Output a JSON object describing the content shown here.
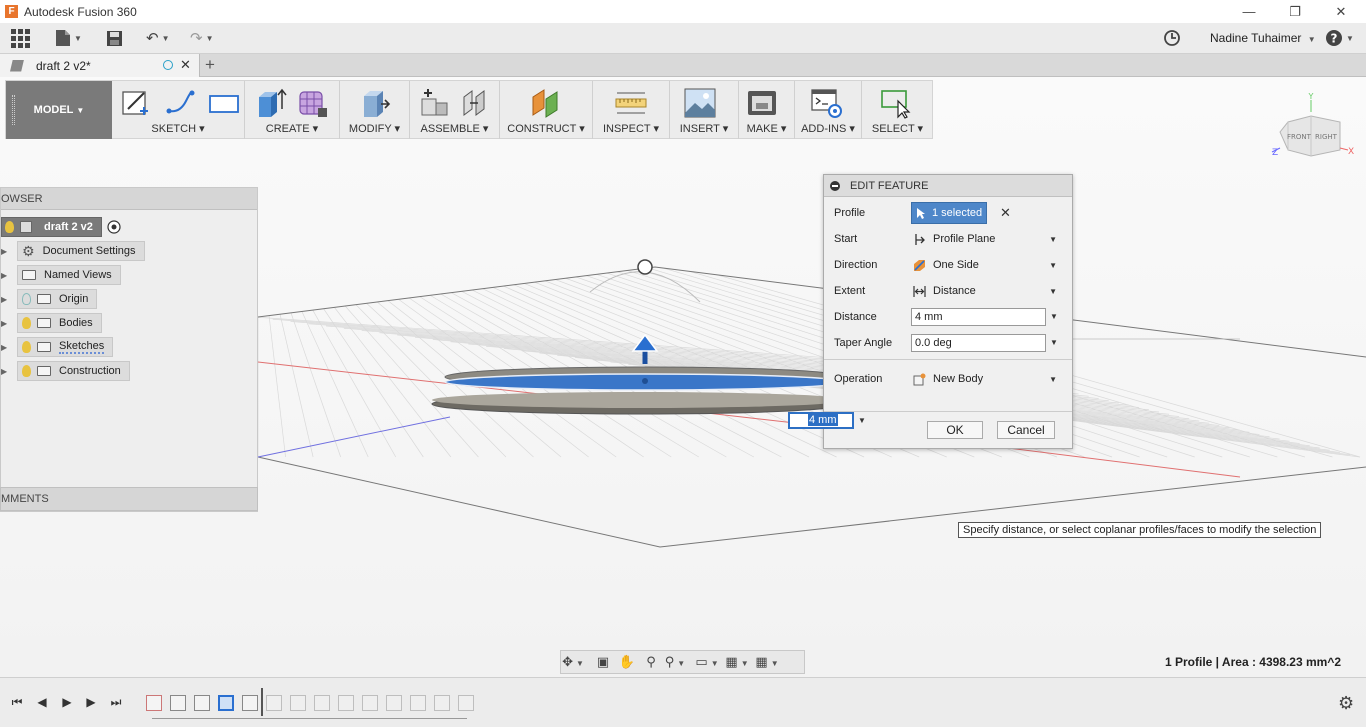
{
  "window": {
    "title": "Autodesk Fusion 360",
    "logo_letter": "F"
  },
  "quick_access": {
    "user": "Nadine Tuhaimer"
  },
  "document_tab": {
    "label": "draft 2 v2*"
  },
  "toolbar": {
    "workspace": "MODEL",
    "groups": [
      "SKETCH",
      "CREATE",
      "MODIFY",
      "ASSEMBLE",
      "CONSTRUCT",
      "INSPECT",
      "INSERT",
      "MAKE",
      "ADD-INS",
      "SELECT"
    ]
  },
  "browser": {
    "header": "OWSER",
    "root": "draft 2 v2",
    "items": [
      "Document Settings",
      "Named Views",
      "Origin",
      "Bodies",
      "Sketches",
      "Construction"
    ],
    "comments": "MMENTS"
  },
  "dialog": {
    "title": "EDIT FEATURE",
    "profile_label": "Profile",
    "profile_value": "1 selected",
    "start_label": "Start",
    "start_value": "Profile Plane",
    "direction_label": "Direction",
    "direction_value": "One Side",
    "extent_label": "Extent",
    "extent_value": "Distance",
    "distance_label": "Distance",
    "distance_value": "4 mm",
    "taper_label": "Taper Angle",
    "taper_value": "0.0 deg",
    "operation_label": "Operation",
    "operation_value": "New Body",
    "ok": "OK",
    "cancel": "Cancel"
  },
  "canvas_input": {
    "value": "4 mm"
  },
  "viewcube": {
    "front": "FRONT",
    "right": "RIGHT",
    "axis_x": "X",
    "axis_y": "Y",
    "axis_z": "Z"
  },
  "tooltip": "Specify distance, or select coplanar profiles/faces to modify the selection",
  "status": "1 Profile | Area : 4398.23 mm^2",
  "colors": {
    "accent": "#4e87c9",
    "workspace": "#7a7a7a",
    "extrude_blue": "#3a76c8"
  }
}
